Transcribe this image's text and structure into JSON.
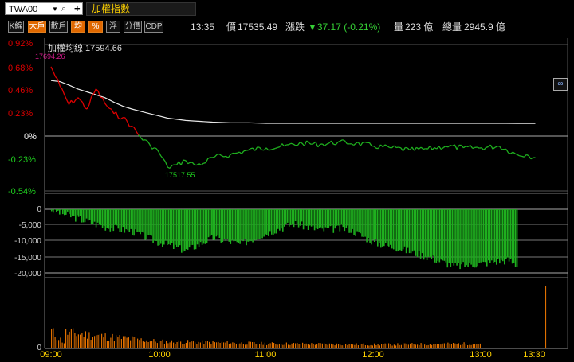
{
  "header": {
    "symbol": "TWA00",
    "dropdown_icon": "chevron-down-icon",
    "search_icon": "search-icon",
    "add_icon": "plus-icon",
    "add_label": "+",
    "index_name": "加權指數"
  },
  "toolbar": {
    "buttons": [
      {
        "label": "K線",
        "active": false
      },
      {
        "label": "大戶",
        "active": true
      },
      {
        "label": "散戶",
        "active": false
      },
      {
        "label": "均",
        "active": true
      },
      {
        "label": "%",
        "active": true
      },
      {
        "label": "浮",
        "active": false
      },
      {
        "label": "分價",
        "active": false
      },
      {
        "label": "CDP",
        "active": false
      }
    ],
    "time": "13:35",
    "price_label": "價",
    "price": "17535.49",
    "change_label": "漲跌",
    "change": "▼37.17 (-0.21%)",
    "volume_label": "量",
    "volume": "223 億",
    "total_volume_label": "總量",
    "total_volume": "2945.9 億"
  },
  "chart": {
    "ma_label": "加權均線 17594.66",
    "link_icon": "link-icon",
    "high_label": "17694.26",
    "low_label": "17517.55",
    "pct_ticks": [
      "0.92%",
      "0.68%",
      "0.46%",
      "0.23%",
      "0%",
      "-0.23%",
      "-0.54%"
    ],
    "mid_ticks": [
      "0",
      "-5,000",
      "-10,000",
      "-15,000",
      "-20,000"
    ],
    "vol_ticks": [
      "0"
    ],
    "time_ticks": [
      "09:00",
      "10:00",
      "11:00",
      "12:00",
      "13:00",
      "13:30"
    ],
    "colors": {
      "up": "#e00000",
      "down": "#1fb01f",
      "ma": "#e0e0e0",
      "volume": "#e07000",
      "axis_label": "#ffd200"
    }
  },
  "chart_data": [
    {
      "type": "line",
      "title": "",
      "xlabel": "",
      "ylabel": "",
      "x": [
        "09:00",
        "09:05",
        "09:10",
        "09:15",
        "09:20",
        "09:25",
        "09:30",
        "09:35",
        "09:40",
        "09:45",
        "09:50",
        "09:55",
        "10:00",
        "10:05",
        "10:10",
        "10:15",
        "10:20",
        "10:25",
        "10:30",
        "10:40",
        "10:50",
        "11:00",
        "11:10",
        "11:20",
        "11:30",
        "11:40",
        "11:50",
        "12:00",
        "12:10",
        "12:20",
        "12:30",
        "12:40",
        "12:50",
        "13:00",
        "13:10",
        "13:20",
        "13:25",
        "13:30"
      ],
      "series": [
        {
          "name": "",
          "values": [
            17694,
            17660,
            17628,
            17640,
            17620,
            17655,
            17630,
            17612,
            17605,
            17590,
            17570,
            17558,
            17545,
            17518,
            17522,
            17530,
            17522,
            17525,
            17535,
            17540,
            17548,
            17552,
            17555,
            17560,
            17558,
            17562,
            17560,
            17555,
            17552,
            17548,
            17550,
            17555,
            17552,
            17552,
            17555,
            17540,
            17540,
            17535
          ]
        },
        {
          "name": "加權均線",
          "values": [
            17670,
            17668,
            17662,
            17655,
            17650,
            17645,
            17640,
            17632,
            17625,
            17620,
            17616,
            17612,
            17608,
            17604,
            17602,
            17600,
            17599,
            17598,
            17597,
            17596,
            17596,
            17595,
            17595,
            17595,
            17595,
            17595,
            17595,
            17595,
            17595,
            17595,
            17595,
            17595,
            17595,
            17595,
            17595,
            17594.66,
            17594.66,
            17594.66
          ]
        }
      ],
      "ylim": [
        "-0.54%",
        "0.92%"
      ]
    },
    {
      "type": "bar",
      "title": "",
      "categories": [
        "09:00",
        "09:15",
        "09:30",
        "09:45",
        "10:00",
        "10:15",
        "10:30",
        "10:45",
        "11:00",
        "11:15",
        "11:30",
        "11:45",
        "12:00",
        "12:15",
        "12:30",
        "12:45",
        "13:00",
        "13:15",
        "13:20"
      ],
      "values": [
        -200,
        -3000,
        -5500,
        -7000,
        -10500,
        -13000,
        -9000,
        -11000,
        -7500,
        -4500,
        -6500,
        -6000,
        -10500,
        -12500,
        -15000,
        -18000,
        -17000,
        -16000,
        -18000
      ],
      "ylim": [
        -20000,
        0
      ]
    },
    {
      "type": "bar",
      "title": "",
      "categories": [
        "09:00",
        "10:00",
        "11:00",
        "12:00",
        "13:00",
        "13:30"
      ],
      "values": [
        8,
        3,
        2,
        1.5,
        2,
        30
      ],
      "ylim": [
        0,
        30
      ]
    }
  ]
}
